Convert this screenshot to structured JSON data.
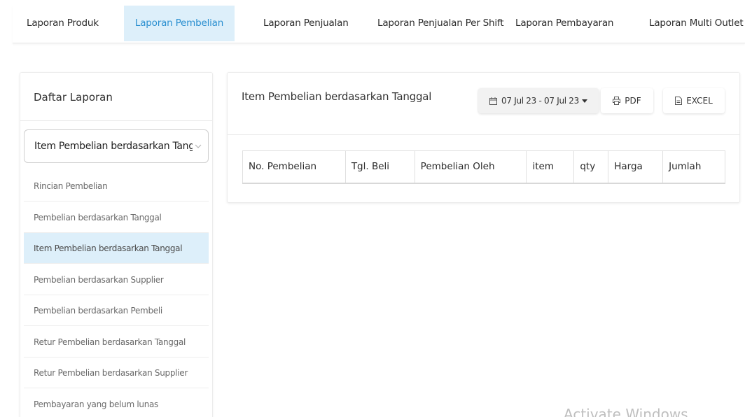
{
  "nav": {
    "tabs": [
      {
        "label": "Laporan Produk",
        "active": false
      },
      {
        "label": "Laporan Pembelian",
        "active": true
      },
      {
        "label": "Laporan Penjualan",
        "active": false
      },
      {
        "label": "Laporan Penjualan Per Shift",
        "active": false
      },
      {
        "label": "Laporan Pembayaran",
        "active": false
      },
      {
        "label": "Laporan Multi Outlet",
        "active": false
      }
    ]
  },
  "sidebar": {
    "title": "Daftar Laporan",
    "select_value": "Item Pembelian berdasarkan Tanggal",
    "items": [
      {
        "label": "Rincian Pembelian",
        "active": false
      },
      {
        "label": "Pembelian berdasarkan Tanggal",
        "active": false
      },
      {
        "label": "Item Pembelian berdasarkan Tanggal",
        "active": true
      },
      {
        "label": "Pembelian berdasarkan Supplier",
        "active": false
      },
      {
        "label": "Pembelian berdasarkan Pembeli",
        "active": false
      },
      {
        "label": "Retur Pembelian berdasarkan Tanggal",
        "active": false
      },
      {
        "label": "Retur Pembelian berdasarkan Supplier",
        "active": false
      },
      {
        "label": "Pembayaran yang belum lunas",
        "active": false
      }
    ]
  },
  "main": {
    "title": "Item Pembelian berdasarkan Tanggal",
    "date_range": "07 Jul 23 - 07 Jul 23",
    "pdf_label": "PDF",
    "excel_label": "EXCEL",
    "table": {
      "headers": [
        "No. Pembelian",
        "Tgl. Beli",
        "Pembelian Oleh",
        "item",
        "qty",
        "Harga",
        "Jumlah"
      ],
      "rows": []
    }
  },
  "watermark": "Activate Windows",
  "colors": {
    "accent": "#2a8fd0",
    "active_bg": "#ddeffa"
  }
}
